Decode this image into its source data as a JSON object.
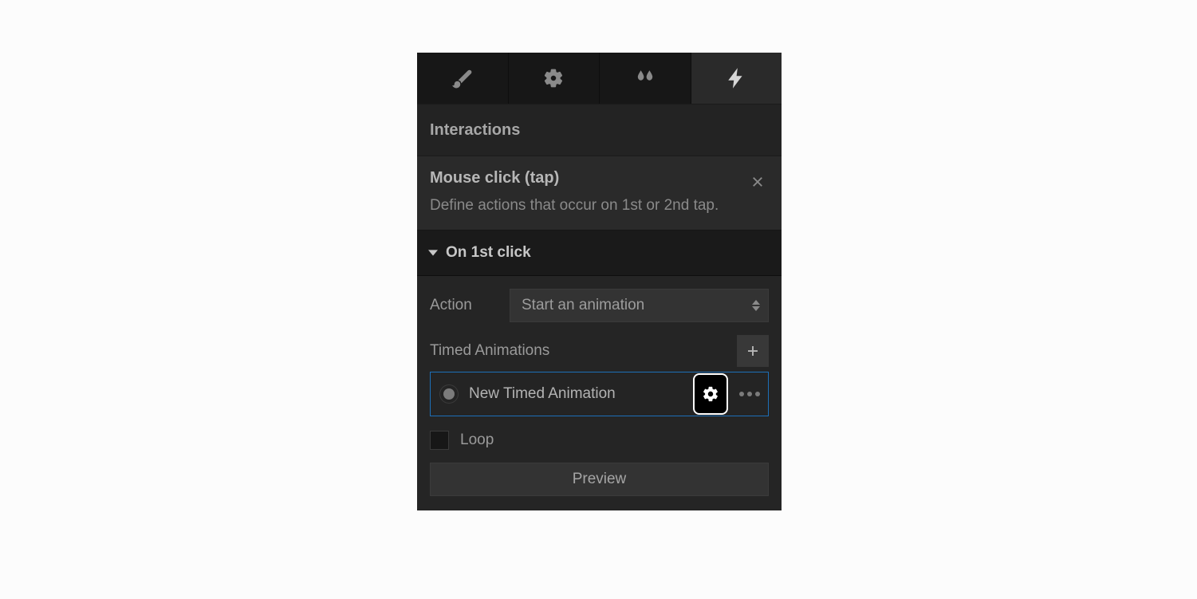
{
  "panel": {
    "section_title": "Interactions",
    "trigger": {
      "title": "Mouse click (tap)",
      "description": "Define actions that occur on 1st or 2nd tap."
    },
    "collapse_label": "On 1st click",
    "action_label": "Action",
    "action_value": "Start an animation",
    "timed_animations_label": "Timed Animations",
    "animations": [
      {
        "name": "New Timed Animation"
      }
    ],
    "loop_label": "Loop",
    "preview_label": "Preview"
  },
  "tabs": [
    {
      "icon": "brush-icon",
      "active": false
    },
    {
      "icon": "gear-icon",
      "active": false
    },
    {
      "icon": "droplet-icon",
      "active": false
    },
    {
      "icon": "lightning-icon",
      "active": true
    }
  ]
}
